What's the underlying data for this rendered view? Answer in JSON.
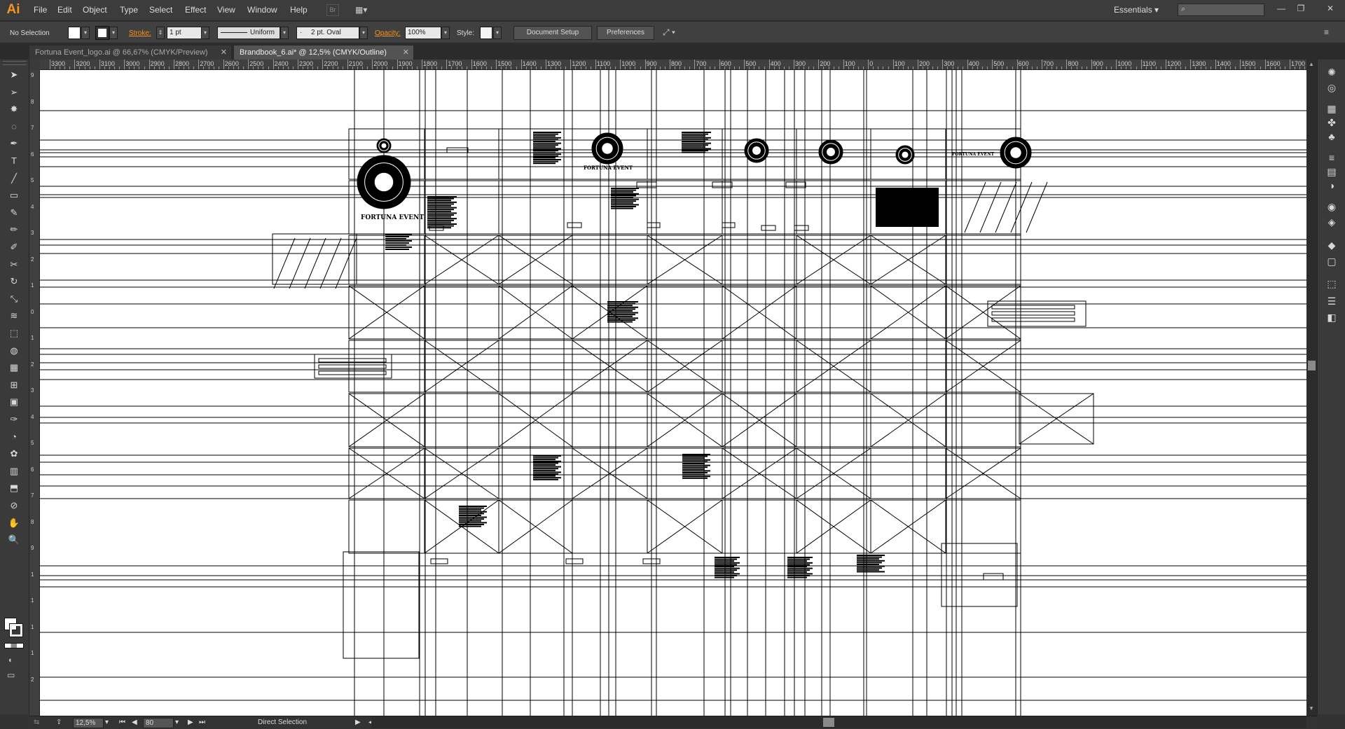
{
  "app": {
    "logo": "Ai"
  },
  "menu": [
    "File",
    "Edit",
    "Object",
    "Type",
    "Select",
    "Effect",
    "View",
    "Window",
    "Help"
  ],
  "workspace": {
    "label": "Essentials ▾",
    "search_placeholder": ""
  },
  "window_controls": {
    "minimize": "—",
    "restore": "❐",
    "close": "✕"
  },
  "control_bar": {
    "selection": "No Selection",
    "stroke_label": "Stroke:",
    "stroke_weight": "1 pt",
    "stroke_profile": "Uniform",
    "brush": "2 pt. Oval",
    "opacity_label": "Opacity:",
    "opacity_value": "100%",
    "style_label": "Style:",
    "document_setup": "Document Setup",
    "preferences": "Preferences"
  },
  "tabs": [
    {
      "label": "Fortuna Event_logo.ai @ 66,67% (CMYK/Preview)",
      "close": "✕",
      "active": false
    },
    {
      "label": "Brandbook_6.ai* @ 12,5% (CMYK/Outline)",
      "close": "✕",
      "active": true
    }
  ],
  "ruler_h": [
    "3300",
    "3200",
    "3100",
    "3000",
    "2900",
    "2800",
    "2700",
    "2600",
    "2500",
    "2400",
    "2300",
    "2200",
    "2100",
    "2000",
    "1900",
    "1800",
    "1700",
    "1600",
    "1500",
    "1400",
    "1300",
    "1200",
    "1100",
    "1000",
    "900",
    "800",
    "700",
    "600",
    "500",
    "400",
    "300",
    "200",
    "100",
    "0",
    "100",
    "200",
    "300",
    "400",
    "500",
    "600",
    "700",
    "800",
    "900",
    "1000",
    "1100",
    "1200",
    "1300",
    "1400",
    "1500",
    "1600",
    "1700"
  ],
  "ruler_v": [
    "9",
    "8",
    "7",
    "6",
    "5",
    "4",
    "3",
    "2",
    "1",
    "0",
    "1",
    "2",
    "3",
    "4",
    "5",
    "6",
    "7",
    "8",
    "9",
    "1",
    "1",
    "1",
    "1",
    "2"
  ],
  "artwork_text": {
    "brand_name": "FORTUNA EVENT"
  },
  "status": {
    "zoom": "12,5%",
    "page": "80",
    "tool": "Direct Selection"
  },
  "tools": [
    "selection-icon",
    "direct-selection-icon",
    "magic-wand-icon",
    "lasso-icon",
    "pen-icon",
    "type-icon",
    "line-icon",
    "rectangle-icon",
    "paintbrush-icon",
    "pencil-icon",
    "blob-brush-icon",
    "scissors-icon",
    "rotate-icon",
    "scale-icon",
    "warp-icon",
    "free-transform-icon",
    "shape-builder-icon",
    "perspective-grid-icon",
    "mesh-icon",
    "gradient-icon",
    "eyedropper-icon",
    "blend-icon",
    "symbol-sprayer-icon",
    "column-graph-icon",
    "artboard-icon",
    "slice-icon",
    "hand-icon",
    "zoom-icon"
  ],
  "right_panels": [
    "color-guide-icon",
    "color-icon",
    "swatches-icon",
    "brushes-icon",
    "symbols-icon",
    "stroke-icon",
    "gradient-panel-icon",
    "transparency-icon",
    "appearance-icon",
    "graphic-styles-icon",
    "layers-icon",
    "artboards-panel-icon",
    "transform-icon",
    "align-icon",
    "pathfinder-icon"
  ]
}
